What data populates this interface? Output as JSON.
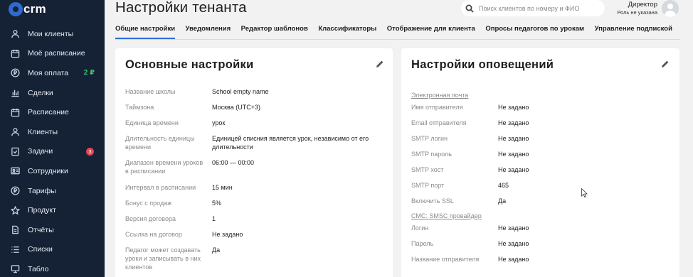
{
  "app": {
    "logo_text": "crm"
  },
  "sidebar": {
    "items": [
      {
        "label": "Мои клиенты",
        "icon": "user-icon"
      },
      {
        "label": "Моё расписание",
        "icon": "calendar-icon"
      },
      {
        "label": "Моя оплата",
        "icon": "ruble-icon",
        "extra": "2 ₽"
      },
      {
        "label": "Сделки",
        "icon": "bar-chart-icon"
      },
      {
        "label": "Расписание",
        "icon": "calendar-icon"
      },
      {
        "label": "Клиенты",
        "icon": "user-icon"
      },
      {
        "label": "Задачи",
        "icon": "task-icon",
        "badge": "3"
      },
      {
        "label": "Сотрудники",
        "icon": "id-card-icon"
      },
      {
        "label": "Тарифы",
        "icon": "ruble-icon"
      },
      {
        "label": "Продукт",
        "icon": "star-icon"
      },
      {
        "label": "Отчёты",
        "icon": "document-icon"
      },
      {
        "label": "Списки",
        "icon": "list-icon"
      },
      {
        "label": "Табло",
        "icon": "board-icon"
      }
    ]
  },
  "header": {
    "title": "Настройки тенанта",
    "search_placeholder": "Поиск клиентов по номеру и ФИО",
    "user_name": "Директор",
    "user_role": "Роль не указана"
  },
  "tabs": [
    {
      "label": "Общие настройки",
      "active": true
    },
    {
      "label": "Уведомления"
    },
    {
      "label": "Редактор шаблонов"
    },
    {
      "label": "Классификаторы"
    },
    {
      "label": "Отображение для клиента"
    },
    {
      "label": "Опросы педагогов по урокам"
    },
    {
      "label": "Управление подпиской"
    }
  ],
  "main_settings": {
    "title": "Основные настройки",
    "rows": [
      {
        "key": "Название школы",
        "value": "School empty name"
      },
      {
        "key": "Таймзона",
        "value": "Москва (UTC+3)"
      },
      {
        "key": "Единица времени",
        "value": "урок"
      },
      {
        "key": "Длительность единицы времени",
        "value": "Единицей списния является урок, независимо от его длительности"
      },
      {
        "key": "Диапазон времени уроков в расписании",
        "value": "06:00 — 00:00"
      },
      {
        "key": "Интервал в расписании",
        "value": "15 мин"
      },
      {
        "key": "Бонус с продаж",
        "value": "5%"
      },
      {
        "key": "Версия договора",
        "value": "1"
      },
      {
        "key": "Ссылка на договор",
        "value": "Не задано"
      },
      {
        "key": "Педагог может создавать уроки и записывать в них клиентов",
        "value": "Да"
      }
    ]
  },
  "notify_settings": {
    "title": "Настройки оповещений",
    "email_section": "Электронная почта",
    "email_rows": [
      {
        "key": "Имя отправителя",
        "value": "Не задано"
      },
      {
        "key": "Email отправителя",
        "value": "Не задано"
      },
      {
        "key": "SMTP логин",
        "value": "Не задано"
      },
      {
        "key": "SMTP пароль",
        "value": "Не задано"
      },
      {
        "key": "SMTP хост",
        "value": "Не задано"
      },
      {
        "key": "SMTP порт",
        "value": "465"
      },
      {
        "key": "Включить SSL",
        "value": "Да"
      }
    ],
    "sms_section": "СМС: SMSC провайдер",
    "sms_rows": [
      {
        "key": "Логин",
        "value": "Не задано"
      },
      {
        "key": "Пароль",
        "value": "Не задано"
      },
      {
        "key": "Название отправителя",
        "value": "Не задано"
      }
    ]
  },
  "colors": {
    "sidebar_bg": "#152235",
    "accent": "#2f6bd6",
    "badge": "#e5454f",
    "balance": "#38c46a"
  }
}
